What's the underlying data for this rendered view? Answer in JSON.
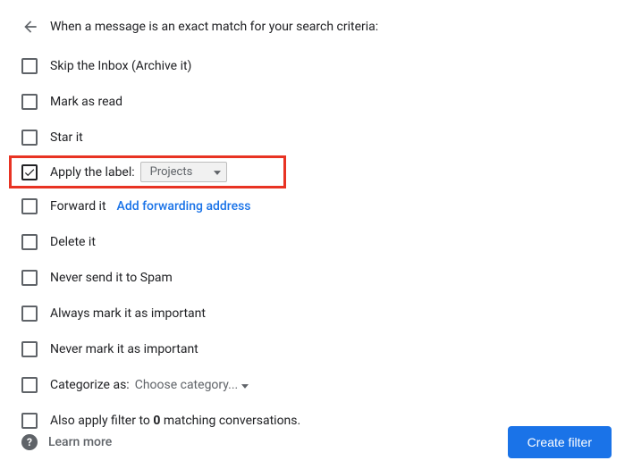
{
  "header": {
    "text": "When a message is an exact match for your search criteria:"
  },
  "options": {
    "skip_inbox": "Skip the Inbox (Archive it)",
    "mark_read": "Mark as read",
    "star": "Star it",
    "apply_label": "Apply the label:",
    "label_value": "Projects",
    "forward": "Forward it",
    "forward_link": "Add forwarding address",
    "delete": "Delete it",
    "never_spam": "Never send it to Spam",
    "always_important": "Always mark it as important",
    "never_important": "Never mark it as important",
    "categorize": "Categorize as:",
    "categorize_value": "Choose category...",
    "also_apply_pre": "Also apply filter to ",
    "also_apply_count": "0",
    "also_apply_post": " matching conversations."
  },
  "footer": {
    "learn_more": "Learn more",
    "create": "Create filter"
  }
}
